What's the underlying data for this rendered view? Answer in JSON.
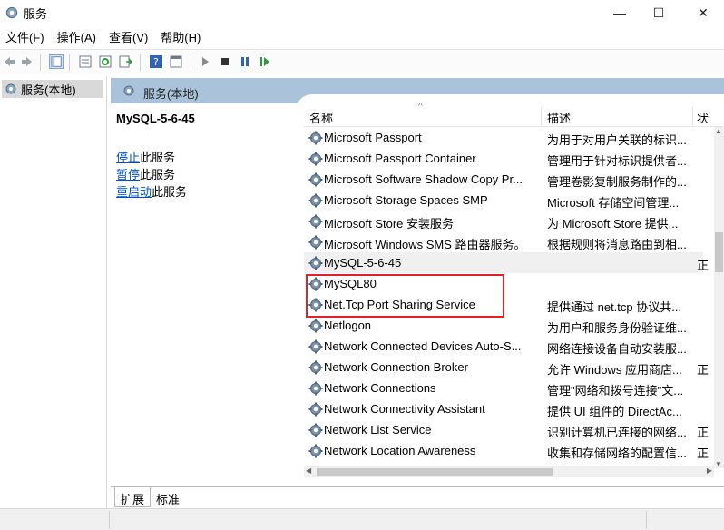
{
  "window": {
    "title": "服务",
    "icon": "services-gear-icon",
    "minimize_glyph": "—",
    "maximize_glyph": "☐",
    "close_glyph": "✕"
  },
  "menu": [
    "文件(F)",
    "操作(A)",
    "查看(V)",
    "帮助(H)"
  ],
  "tree": {
    "label": "服务(本地)"
  },
  "panel": {
    "header": "服务(本地)",
    "selected_service": "MySQL-5-6-45",
    "actions": [
      {
        "link": "停止",
        "rest": "此服务"
      },
      {
        "link": "暂停",
        "rest": "此服务"
      },
      {
        "link": "重启动",
        "rest": "此服务"
      }
    ]
  },
  "columns": {
    "name": "名称",
    "desc": "描述",
    "state": "状"
  },
  "rows": [
    {
      "name": "Microsoft Passport",
      "desc": "为用于对用户关联的标识...",
      "state": ""
    },
    {
      "name": "Microsoft Passport Container",
      "desc": "管理用于针对标识提供者...",
      "state": ""
    },
    {
      "name": "Microsoft Software Shadow Copy Pr...",
      "desc": "管理卷影复制服务制作的...",
      "state": ""
    },
    {
      "name": "Microsoft Storage Spaces SMP",
      "desc": "Microsoft 存储空间管理...",
      "state": ""
    },
    {
      "name": "Microsoft Store 安装服务",
      "desc": "为 Microsoft Store 提供...",
      "state": ""
    },
    {
      "name": "Microsoft Windows SMS 路由器服务。",
      "desc": "根据规则将消息路由到相...",
      "state": ""
    },
    {
      "name": "MySQL-5-6-45",
      "desc": "",
      "state": "正"
    },
    {
      "name": "MySQL80",
      "desc": "",
      "state": ""
    },
    {
      "name": "Net.Tcp Port Sharing Service",
      "desc": "提供通过 net.tcp 协议共...",
      "state": ""
    },
    {
      "name": "Netlogon",
      "desc": "为用户和服务身份验证维...",
      "state": ""
    },
    {
      "name": "Network Connected Devices Auto-S...",
      "desc": "网络连接设备自动安装服...",
      "state": ""
    },
    {
      "name": "Network Connection Broker",
      "desc": "允许 Windows 应用商店...",
      "state": "正"
    },
    {
      "name": "Network Connections",
      "desc": "管理\"网络和拨号连接\"文...",
      "state": ""
    },
    {
      "name": "Network Connectivity Assistant",
      "desc": "提供 UI 组件的 DirectAc...",
      "state": ""
    },
    {
      "name": "Network List Service",
      "desc": "识别计算机已连接的网络...",
      "state": "正"
    },
    {
      "name": "Network Location Awareness",
      "desc": "收集和存储网络的配置信...",
      "state": "正"
    }
  ],
  "tabs": [
    "扩展",
    "标准"
  ],
  "colors": {
    "panel_header": "#abc3da",
    "highlight_border": "#e0202a",
    "link": "#0050c8"
  }
}
